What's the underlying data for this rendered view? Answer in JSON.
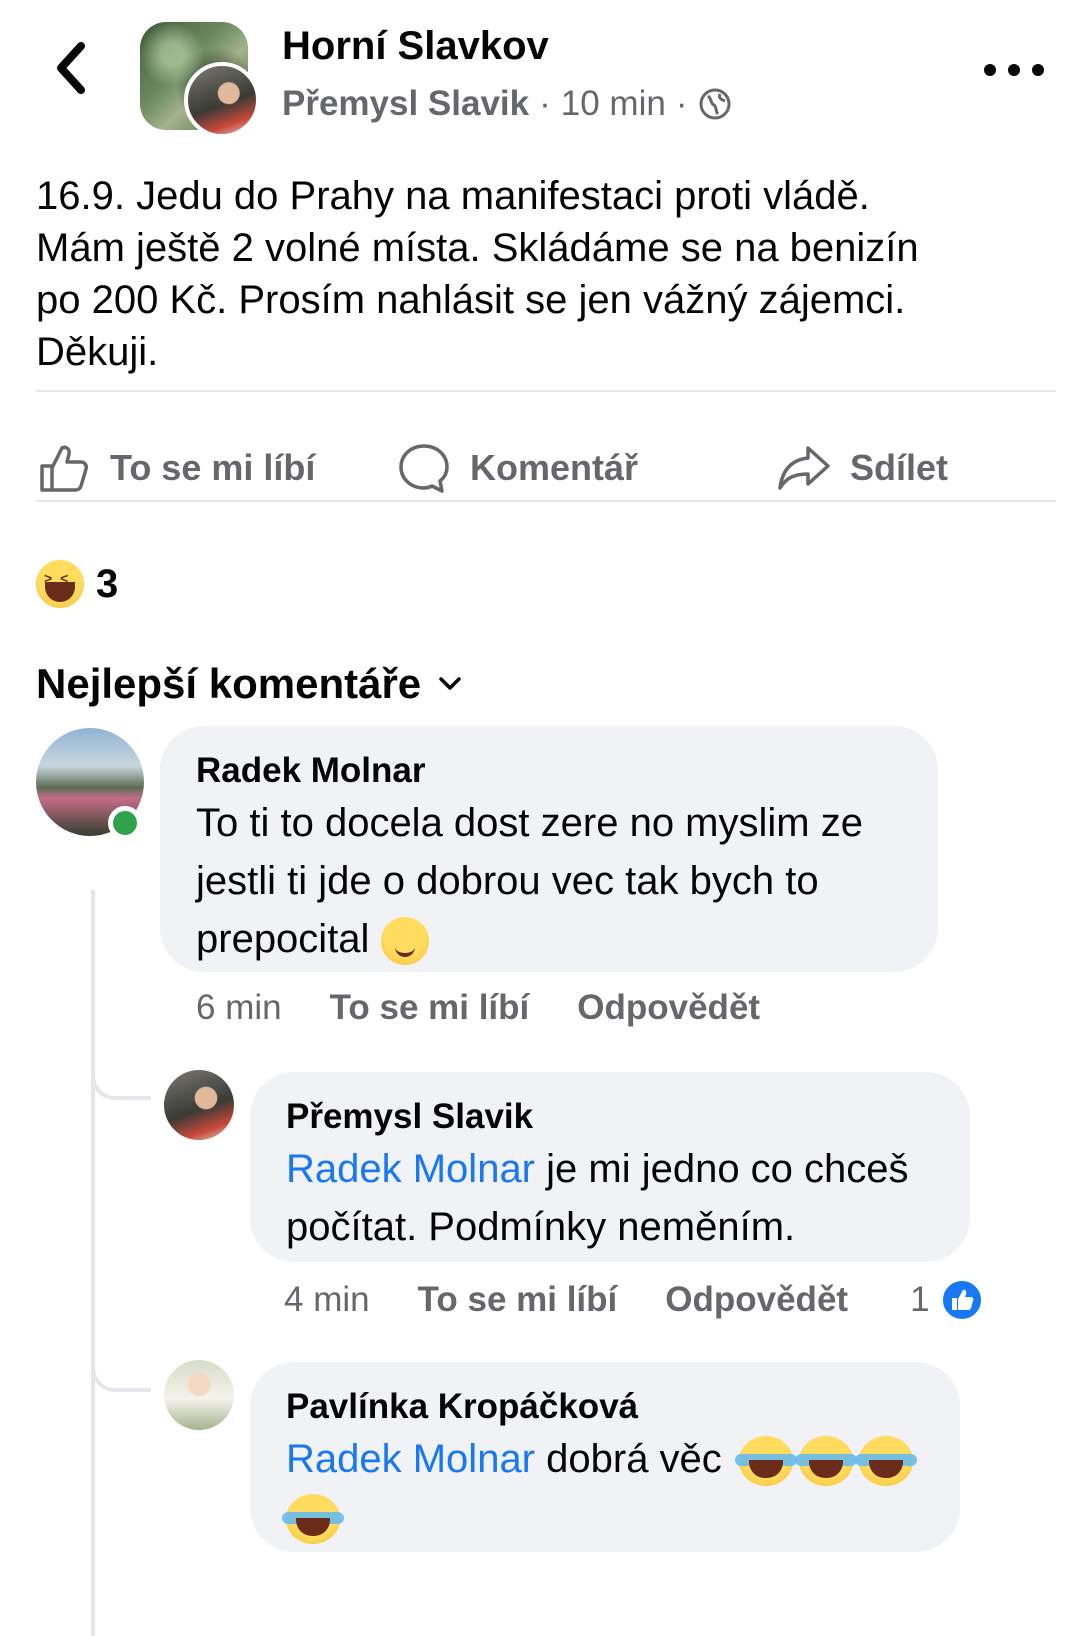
{
  "header": {
    "group_name": "Horní Slavkov",
    "author": "Přemysl Slavik",
    "separator": "·",
    "time": "10 min",
    "privacy_icon": "globe-icon"
  },
  "post": {
    "text": "16.9. Jedu do Prahy na manifestaci proti vládě.\nMám ještě 2 volné místa. Skládáme se na benizín\npo 200 Kč. Prosím nahlásit se jen vážný zájemci.\nDěkuji."
  },
  "actions": {
    "like": "To se mi líbí",
    "comment": "Komentář",
    "share": "Sdílet"
  },
  "reactions": {
    "icon": "haha-emoji",
    "count": "3"
  },
  "comments_header": {
    "label": "Nejlepší komentáře"
  },
  "comments": [
    {
      "name": "Radek Molnar",
      "text": "To ti to docela dost zere no myslim ze\njestli ti jde o dobrou vec tak bych to\nprepocital",
      "time": "6 min",
      "like": "To se mi líbí",
      "reply": "Odpovědět",
      "online": true
    },
    {
      "name": "Přemysl Slavik",
      "mention": "Radek Molnar",
      "text": " je mi jedno co chceš\npočítat. Podmínky neměním.",
      "time": "4 min",
      "like": "To se mi líbí",
      "reply": "Odpovědět",
      "like_count": "1"
    },
    {
      "name": "Pavlínka Kropáčková",
      "mention": "Radek Molnar",
      "text": " dobrá věc"
    }
  ],
  "colors": {
    "accent": "#1877f2",
    "secondary_text": "#65676b",
    "bubble": "#f0f2f5",
    "online": "#31a24c"
  }
}
